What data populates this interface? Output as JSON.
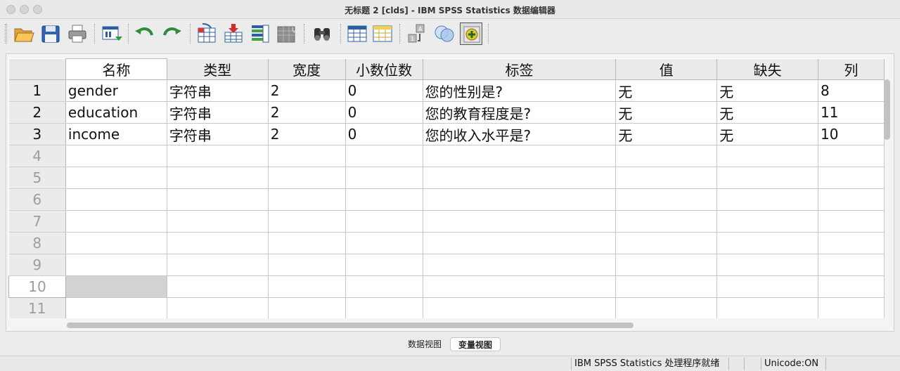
{
  "window": {
    "title": "无标题 2 [clds] - IBM SPSS Statistics 数据编辑器"
  },
  "toolbar": {
    "buttons": [
      {
        "name": "open-icon"
      },
      {
        "name": "save-icon"
      },
      {
        "name": "print-icon"
      },
      {
        "name": "dialog-recall-icon"
      },
      {
        "name": "undo-icon"
      },
      {
        "name": "redo-icon"
      },
      {
        "name": "goto-case-icon"
      },
      {
        "name": "goto-variable-icon"
      },
      {
        "name": "variables-icon"
      },
      {
        "name": "run-descriptives-icon"
      },
      {
        "name": "find-icon"
      },
      {
        "name": "insert-cases-icon"
      },
      {
        "name": "insert-variable-icon"
      },
      {
        "name": "split-file-icon"
      },
      {
        "name": "select-cases-icon"
      },
      {
        "name": "value-labels-icon"
      }
    ]
  },
  "grid": {
    "headers": [
      "名称",
      "类型",
      "宽度",
      "小数位数",
      "标签",
      "值",
      "缺失",
      "列"
    ],
    "rows": [
      {
        "num": "1",
        "cells": [
          "gender",
          "字符串",
          "2",
          "0",
          "您的性别是?",
          "无",
          "无",
          "8"
        ]
      },
      {
        "num": "2",
        "cells": [
          "education",
          "字符串",
          "2",
          "0",
          "您的教育程度是?",
          "无",
          "无",
          "11"
        ]
      },
      {
        "num": "3",
        "cells": [
          "income",
          "字符串",
          "2",
          "0",
          "您的收入水平是?",
          "无",
          "无",
          "10"
        ]
      },
      {
        "num": "4",
        "cells": [
          "",
          "",
          "",
          "",
          "",
          "",
          "",
          ""
        ]
      },
      {
        "num": "5",
        "cells": [
          "",
          "",
          "",
          "",
          "",
          "",
          "",
          ""
        ]
      },
      {
        "num": "6",
        "cells": [
          "",
          "",
          "",
          "",
          "",
          "",
          "",
          ""
        ]
      },
      {
        "num": "7",
        "cells": [
          "",
          "",
          "",
          "",
          "",
          "",
          "",
          ""
        ]
      },
      {
        "num": "8",
        "cells": [
          "",
          "",
          "",
          "",
          "",
          "",
          "",
          ""
        ]
      },
      {
        "num": "9",
        "cells": [
          "",
          "",
          "",
          "",
          "",
          "",
          "",
          ""
        ]
      },
      {
        "num": "10",
        "cells": [
          "",
          "",
          "",
          "",
          "",
          "",
          "",
          ""
        ]
      },
      {
        "num": "11",
        "cells": [
          "",
          "",
          "",
          "",
          "",
          "",
          "",
          ""
        ]
      }
    ],
    "active_row": "10"
  },
  "tabs": {
    "data_view": "数据视图",
    "variable_view": "变量视图",
    "active": "variable_view"
  },
  "status": {
    "processor": "IBM SPSS Statistics 处理程序就绪",
    "unicode": "Unicode:ON"
  }
}
